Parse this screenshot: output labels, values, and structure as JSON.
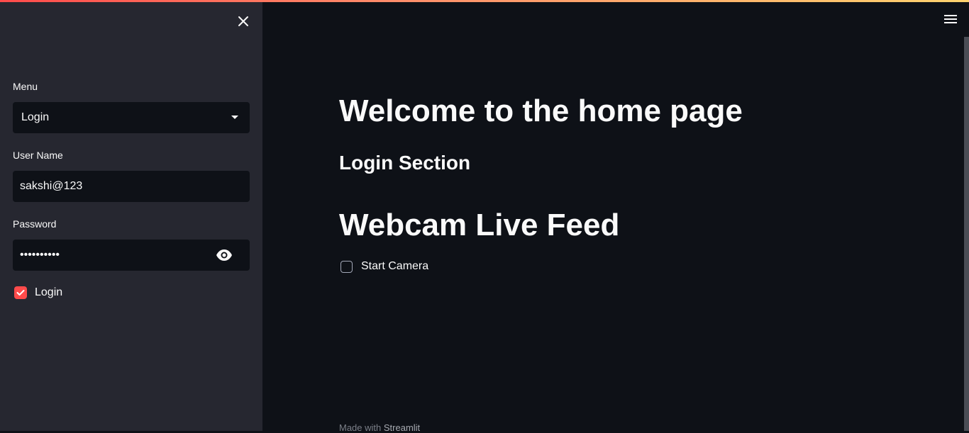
{
  "sidebar": {
    "menu_label": "Menu",
    "menu_selected": "Login",
    "username_label": "User Name",
    "username_value": "sakshi@123",
    "password_label": "Password",
    "password_value": "••••••••••",
    "login_checkbox_label": "Login",
    "login_checked": true
  },
  "main": {
    "title": "Welcome to the home page",
    "section_heading": "Login Section",
    "webcam_heading": "Webcam Live Feed",
    "camera_checkbox_label": "Start Camera",
    "camera_checked": false,
    "footer_prefix": "Made with ",
    "footer_brand": "Streamlit"
  },
  "colors": {
    "accent": "#ff4b4b",
    "sidebar_bg": "#262730",
    "main_bg": "#0e1117",
    "input_bg": "#0e1117"
  },
  "icons": [
    "close-icon",
    "chevron-down-icon",
    "eye-icon",
    "check-icon",
    "hamburger-menu-icon"
  ]
}
